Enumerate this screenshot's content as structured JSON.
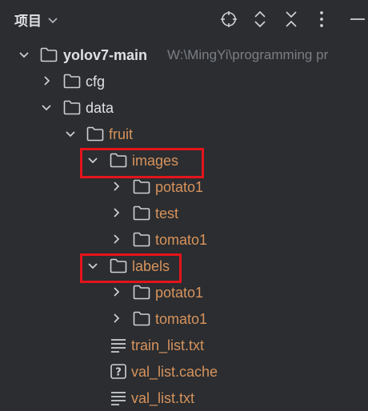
{
  "panel": {
    "title": "项目"
  },
  "tree": {
    "root": {
      "label": "yolov7-main",
      "path": "W:\\MingYi\\programming pr"
    },
    "cfg": "cfg",
    "data": "data",
    "fruit": "fruit",
    "images": "images",
    "images_children": [
      "potato1",
      "test",
      "tomato1"
    ],
    "labels": "labels",
    "labels_children": [
      "potato1",
      "tomato1"
    ],
    "files": [
      "train_list.txt",
      "val_list.cache",
      "val_list.txt"
    ]
  },
  "colors": {
    "background": "#2b2d30",
    "excluded_folder_text": "#d7935c",
    "normal_text": "#dfe1e5",
    "annotation_box": "#e4141b"
  }
}
